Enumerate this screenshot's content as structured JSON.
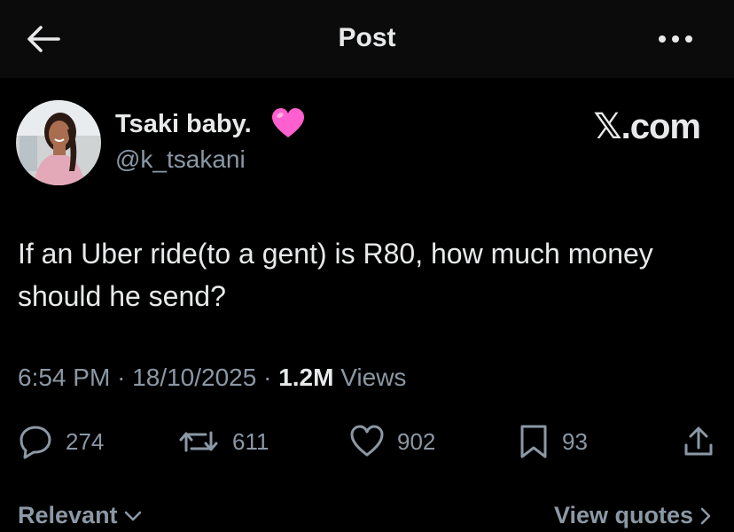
{
  "header": {
    "title": "Post"
  },
  "author": {
    "name": "Tsaki baby.",
    "handle": "@k_tsakani",
    "emoji": "pink-heart"
  },
  "watermark": {
    "x": "𝕏",
    "domain": ".com"
  },
  "post": {
    "text": "If an Uber ride(to a gent) is R80, how much money should he send?",
    "time": "6:54 PM",
    "date": "18/10/2025",
    "views_count": "1.2M",
    "views_label": "Views"
  },
  "actions": {
    "replies": "274",
    "reposts": "611",
    "likes": "902",
    "bookmarks": "93"
  },
  "footer": {
    "sort_label": "Relevant",
    "quotes_label": "View quotes"
  },
  "colors": {
    "background": "#000000",
    "header_bg": "#0b0b0b",
    "text_primary": "#e7e9ea",
    "text_secondary": "#8b98a5",
    "heart": "#ff5fcf"
  }
}
